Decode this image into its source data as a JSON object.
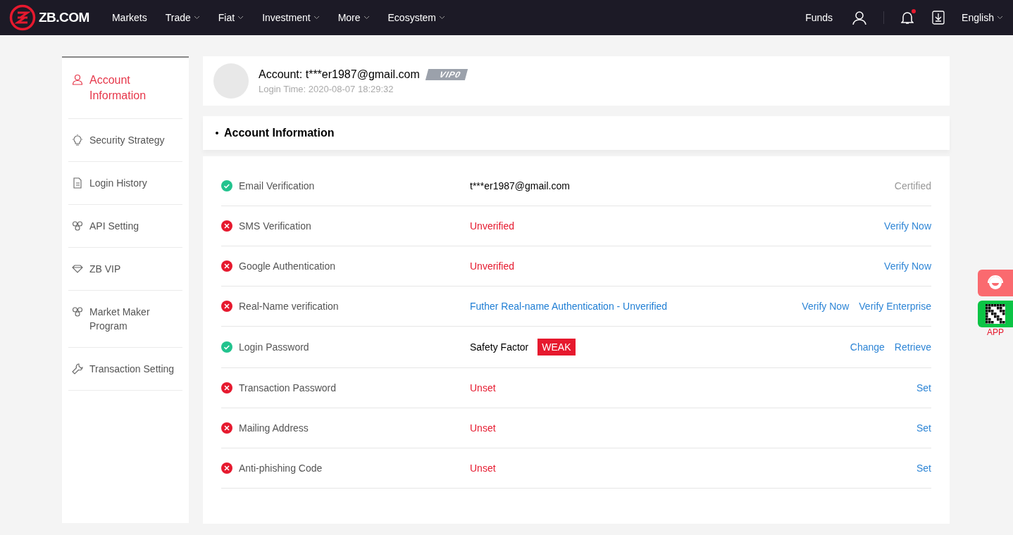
{
  "header": {
    "logo": "ZB.COM",
    "menu": [
      {
        "label": "Markets",
        "dropdown": false
      },
      {
        "label": "Trade",
        "dropdown": true
      },
      {
        "label": "Fiat",
        "dropdown": true
      },
      {
        "label": "Investment",
        "dropdown": true
      },
      {
        "label": "More",
        "dropdown": true
      },
      {
        "label": "Ecosystem",
        "dropdown": true
      }
    ],
    "funds": "Funds",
    "notification_unread": true,
    "language": "English"
  },
  "sidebar": {
    "items": [
      {
        "label": "Account Information",
        "selected": true
      },
      {
        "label": "Security Strategy",
        "selected": false
      },
      {
        "label": "Login History",
        "selected": false
      },
      {
        "label": "API Setting",
        "selected": false
      },
      {
        "label": "ZB VIP",
        "selected": false
      },
      {
        "label": "Market Maker Program",
        "selected": false
      },
      {
        "label": "Transaction Setting",
        "selected": false
      }
    ]
  },
  "profile": {
    "account": "Account: t***er1987@gmail.com",
    "vip": "VIP0",
    "login_time": "Login Time: 2020-08-07 18:29:32"
  },
  "section": {
    "title": "Account Information"
  },
  "rows": [
    {
      "verified": true,
      "label": "Email Verification",
      "kind": "plain",
      "value": "t***er1987@gmail.com",
      "actions": [
        {
          "label": "Certified",
          "enabled": false
        }
      ]
    },
    {
      "verified": false,
      "label": "SMS Verification",
      "kind": "warning",
      "value": "Unverified",
      "actions": [
        {
          "label": "Verify Now",
          "enabled": true
        }
      ]
    },
    {
      "verified": false,
      "label": "Google Authentication",
      "kind": "warning",
      "value": "Unverified",
      "actions": [
        {
          "label": "Verify Now",
          "enabled": true
        }
      ]
    },
    {
      "verified": false,
      "label": "Real-Name verification",
      "kind": "link",
      "value": "Futher Real-name Authentication - Unverified",
      "actions": [
        {
          "label": "Verify Now",
          "enabled": true
        },
        {
          "label": "Verify Enterprise",
          "enabled": true
        }
      ]
    },
    {
      "verified": true,
      "label": "Login Password",
      "kind": "strength",
      "value": "Safety Factor",
      "strength": "WEAK",
      "actions": [
        {
          "label": "Change",
          "enabled": true
        },
        {
          "label": "Retrieve",
          "enabled": true
        }
      ]
    },
    {
      "verified": false,
      "label": "Transaction Password",
      "kind": "warning",
      "value": "Unset",
      "actions": [
        {
          "label": "Set",
          "enabled": true
        }
      ]
    },
    {
      "verified": false,
      "label": "Mailing Address",
      "kind": "warning",
      "value": "Unset",
      "actions": [
        {
          "label": "Set",
          "enabled": true
        }
      ]
    },
    {
      "verified": false,
      "label": "Anti-phishing Code",
      "kind": "warning",
      "value": "Unset",
      "actions": [
        {
          "label": "Set",
          "enabled": true
        }
      ]
    }
  ],
  "float": {
    "app_label": "APP"
  }
}
